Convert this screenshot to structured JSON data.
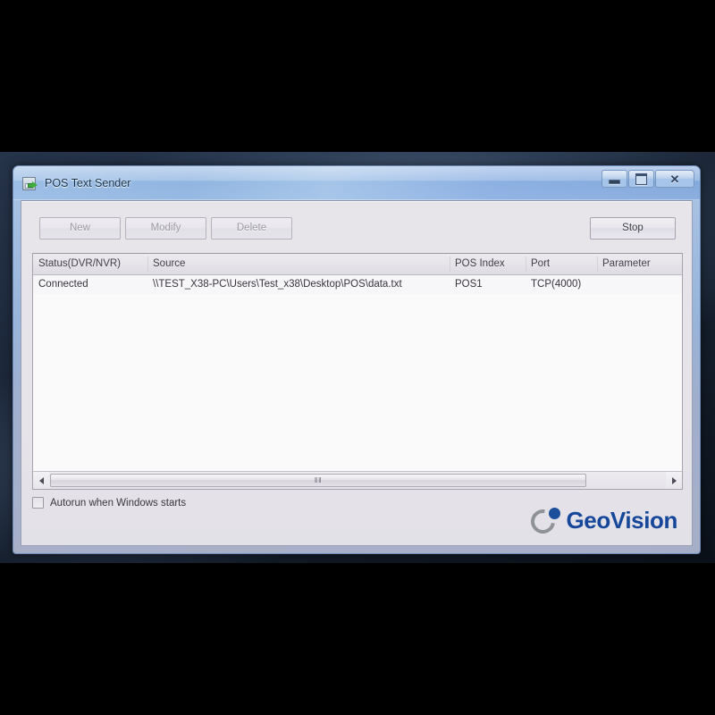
{
  "window": {
    "title": "POS Text Sender",
    "app_icon": "save-disk-green-arrow-icon",
    "controls": {
      "minimize_label": "",
      "maximize_label": "",
      "close_label": "✕",
      "minimize_name": "minimize-button",
      "maximize_name": "maximize-button",
      "close_name": "close-button"
    }
  },
  "toolbar": {
    "new_label": "New",
    "modify_label": "Modify",
    "delete_label": "Delete",
    "stop_label": "Stop",
    "new_enabled": false,
    "modify_enabled": false,
    "delete_enabled": false,
    "stop_enabled": true
  },
  "table": {
    "columns": [
      {
        "key": "status",
        "label": "Status(DVR/NVR)"
      },
      {
        "key": "source",
        "label": "Source"
      },
      {
        "key": "pos_index",
        "label": "POS Index"
      },
      {
        "key": "port",
        "label": "Port"
      },
      {
        "key": "parameter",
        "label": "Parameter"
      }
    ],
    "rows": [
      {
        "status": "Connected",
        "source": "\\\\TEST_X38-PC\\Users\\Test_x38\\Desktop\\POS\\data.txt",
        "pos_index": "POS1",
        "port": "TCP(4000)",
        "parameter": ""
      }
    ]
  },
  "scrollbar": {
    "left_arrow": "◂",
    "right_arrow": "▸",
    "grip": "‖‖",
    "thumb_width_percent": 87
  },
  "footer": {
    "autorun_label": "Autorun when Windows starts",
    "autorun_checked": false,
    "logo_text": "GeoVision",
    "logo_accent_color": "#16479a",
    "logo_crescent_color": "#8f9297"
  }
}
